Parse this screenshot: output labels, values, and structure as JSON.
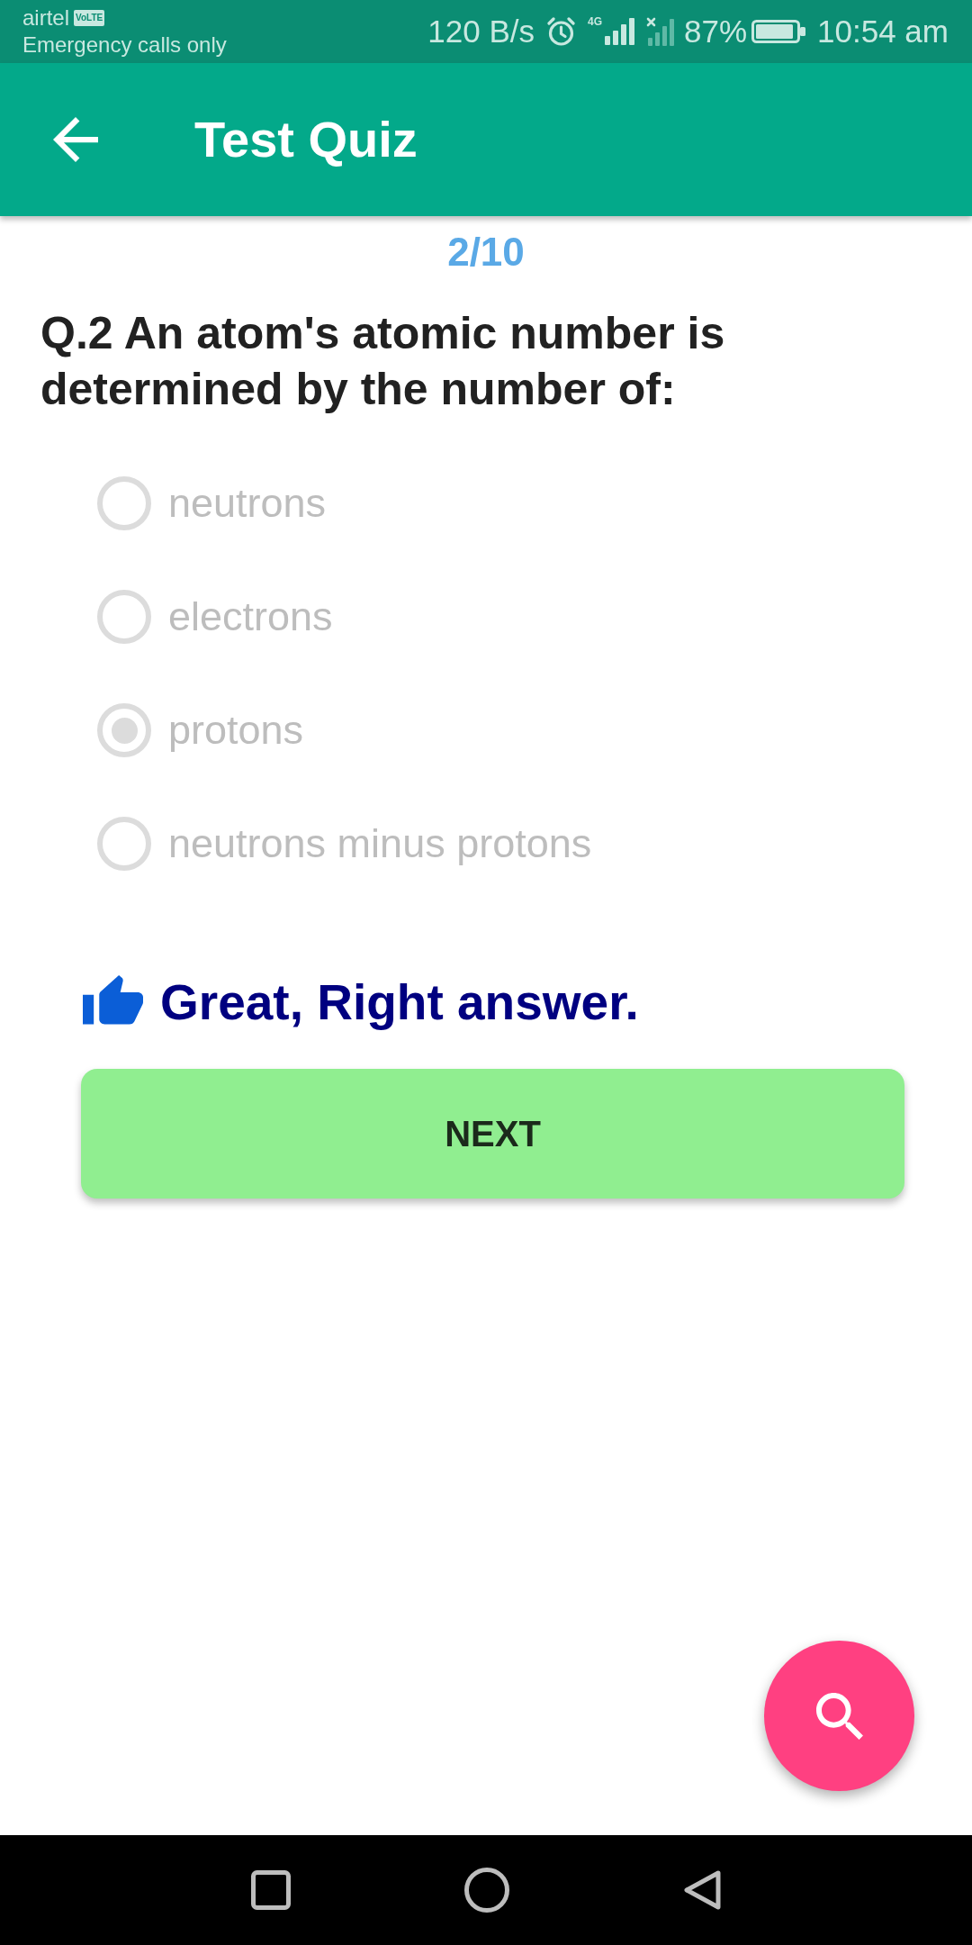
{
  "status_bar": {
    "carrier": "airtel",
    "network_badge": "VoLTE",
    "carrier_status": "Emergency calls only",
    "data_speed": "120 B/s",
    "network_type": "4G",
    "battery_percent": "87%",
    "time": "10:54 am"
  },
  "app_bar": {
    "title": "Test Quiz"
  },
  "quiz": {
    "question_counter": "2/10",
    "question": "Q.2 An atom's atomic number is determined by the number of:",
    "options": [
      {
        "label": "neutrons",
        "selected": false,
        "disabled": true
      },
      {
        "label": "electrons",
        "selected": false,
        "disabled": true
      },
      {
        "label": "protons",
        "selected": true,
        "disabled": true
      },
      {
        "label": "neutrons minus protons",
        "selected": false,
        "disabled": true
      }
    ]
  },
  "feedback": {
    "kind": "correct",
    "text": "Great, Right answer."
  },
  "next_button": {
    "label": "NEXT"
  }
}
